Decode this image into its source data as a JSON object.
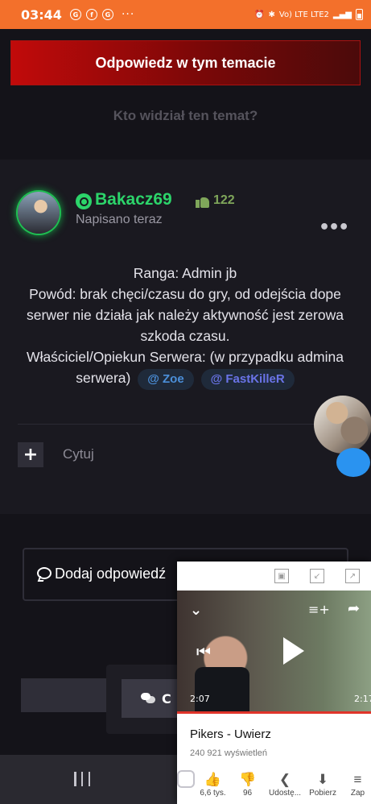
{
  "status_bar": {
    "time": "03:44",
    "left_icons": [
      "vk-icon",
      "facebook-icon",
      "vk-icon"
    ],
    "left_icon_glyphs": [
      "G",
      "f",
      "G"
    ],
    "more": "···",
    "network": "Vo) LTE LTE2",
    "right_icons": [
      "alarm-icon",
      "bluetooth-icon",
      "signal-icon",
      "battery-icon"
    ]
  },
  "reply_button": {
    "label": "Odpowiedz w tym temacie"
  },
  "who_viewed": "Kto widział ten temat?",
  "post": {
    "author": "Bakacz69",
    "reputation": "122",
    "posted": "Napisano teraz",
    "more": "•••",
    "body_lines": [
      "Ranga: Admin jb",
      "Powód: brak chęci/czasu do gry, od odejścia dope serwer nie działa jak należy aktywność jest zerowa szkoda czasu.",
      "Właściciel/Opiekun Serwera: (w przypadku admina serwera)"
    ],
    "mentions": [
      "@ Zoe",
      "@ FastKilleR"
    ],
    "quote_label": "Cytuj",
    "plus": "+"
  },
  "add_reply": {
    "label": "Dodaj odpowiedź"
  },
  "chat_button": {
    "letter": "C"
  },
  "mini_player": {
    "chevron": "⌄",
    "queue": "≡+",
    "share": "➦",
    "prev": "⏮",
    "time_current": "2:07",
    "time_total": "2:17",
    "title": "Pikers - Uwierz",
    "views": "240 921 wyświetleń",
    "actions": [
      {
        "icon": "like-icon",
        "glyph": "👍",
        "label": "6,6 tys."
      },
      {
        "icon": "dislike-icon",
        "glyph": "👎",
        "label": "96"
      },
      {
        "icon": "share-icon",
        "glyph": "❮",
        "label": "Udostę..."
      },
      {
        "icon": "download-icon",
        "glyph": "⬇",
        "label": "Pobierz"
      },
      {
        "icon": "save-icon",
        "glyph": "≡",
        "label": "Zap"
      }
    ]
  },
  "colors": {
    "status_bar": "#f3702b",
    "accent_red": "#c10a0a",
    "username": "#2cd46a",
    "reputation": "#7fa65a",
    "mention": "#4b8fd9"
  }
}
